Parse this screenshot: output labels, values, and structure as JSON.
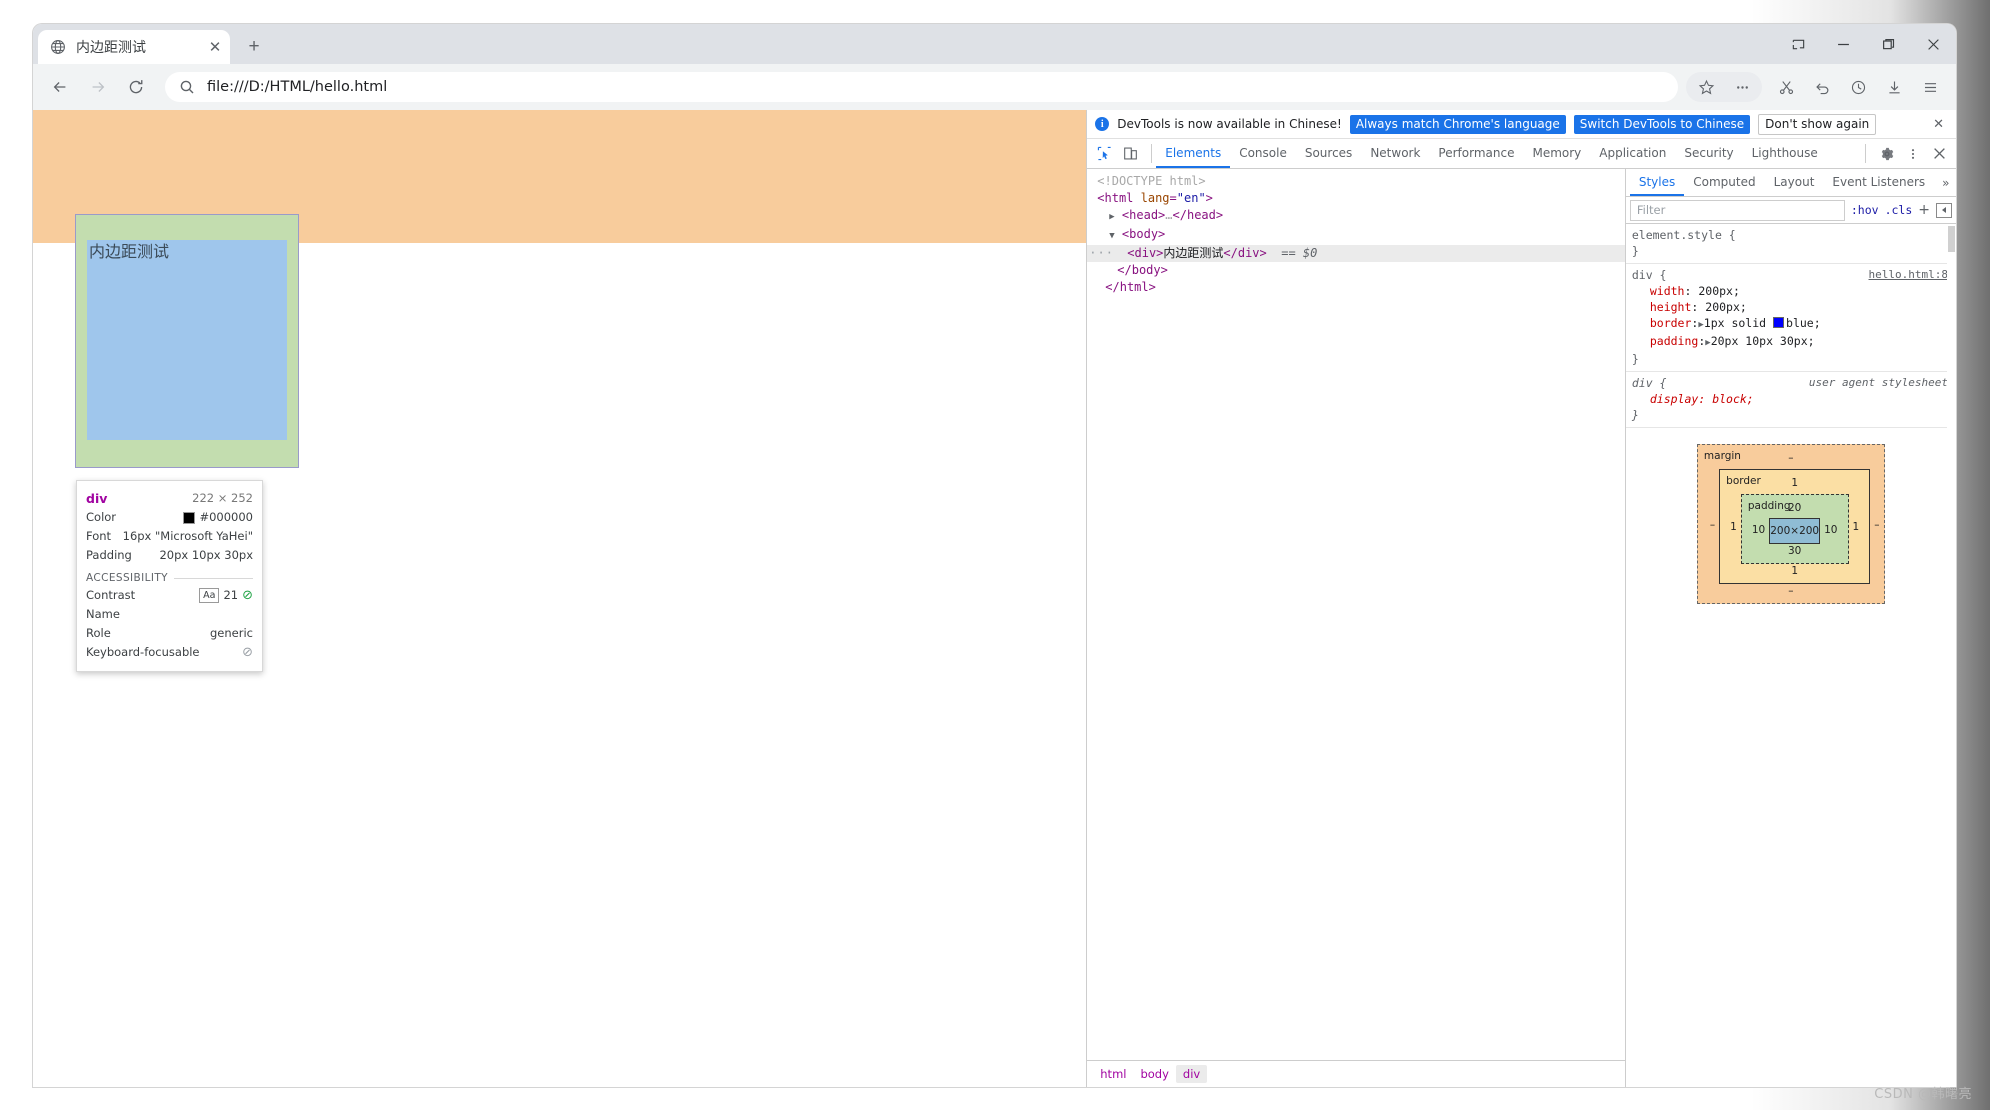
{
  "window": {
    "controls": [
      {
        "name": "cast-icon",
        "glyph": "cast"
      },
      {
        "name": "minimize-button",
        "glyph": "minimize"
      },
      {
        "name": "maximize-button",
        "glyph": "maximize"
      },
      {
        "name": "close-button",
        "glyph": "close"
      }
    ]
  },
  "tab": {
    "title": "内边距测试",
    "favicon": "globe-icon",
    "close_label": "✕",
    "newtab_label": "+"
  },
  "nav": {
    "back": "←",
    "forward": "→",
    "reload": "⟳",
    "url": "file:///D:/HTML/hello.html",
    "search_icon": "search-icon",
    "toolbar_icons": [
      "bookmark-star-icon",
      "extensions-ellipsis-icon",
      "scissors-icon",
      "undo-icon",
      "history-clock-icon",
      "download-icon",
      "menu-hamburger-icon"
    ]
  },
  "page": {
    "div_text": "内边距测试",
    "colors": {
      "content": "#9fc6ec",
      "padding": "#c3ddaf",
      "margin": "#f8cc9c",
      "border_outline": "#9a9aca"
    }
  },
  "tooltip": {
    "tag": "div",
    "dimensions": "222 × 252",
    "rows": [
      {
        "key": "Color",
        "value": "#000000",
        "swatch": "#000000"
      },
      {
        "key": "Font",
        "value": "16px \"Microsoft YaHei\""
      },
      {
        "key": "Padding",
        "value": "20px 10px 30px"
      }
    ],
    "accessibility_title": "ACCESSIBILITY",
    "a11y": [
      {
        "key": "Contrast",
        "badge": "Aa",
        "value": "21",
        "status": "pass"
      },
      {
        "key": "Name",
        "value": ""
      },
      {
        "key": "Role",
        "value": "generic"
      },
      {
        "key": "Keyboard-focusable",
        "value": "",
        "status": "no"
      }
    ]
  },
  "devtools": {
    "banner": {
      "icon": "info-icon",
      "message": "DevTools is now available in Chinese!",
      "buttons": [
        {
          "label": "Always match Chrome's language",
          "style": "blue"
        },
        {
          "label": "Switch DevTools to Chinese",
          "style": "blue"
        },
        {
          "label": "Don't show again",
          "style": "plain"
        }
      ],
      "close": "✕"
    },
    "tool_icons": [
      "inspect-element-icon",
      "device-toolbar-icon"
    ],
    "tabs": [
      {
        "label": "Elements",
        "selected": true
      },
      {
        "label": "Console",
        "selected": false
      },
      {
        "label": "Sources",
        "selected": false
      },
      {
        "label": "Network",
        "selected": false
      },
      {
        "label": "Performance",
        "selected": false
      },
      {
        "label": "Memory",
        "selected": false
      },
      {
        "label": "Application",
        "selected": false
      },
      {
        "label": "Security",
        "selected": false
      },
      {
        "label": "Lighthouse",
        "selected": false
      }
    ],
    "right_icons": [
      "settings-gear-icon",
      "more-vertical-icon",
      "close-devtools-icon"
    ],
    "dom": {
      "lines": [
        {
          "indent": 0,
          "parts": [
            {
              "t": "cm",
              "v": "<!DOCTYPE html>"
            }
          ]
        },
        {
          "indent": 0,
          "parts": [
            {
              "t": "tg",
              "v": "<html "
            },
            {
              "t": "at",
              "v": "lang"
            },
            {
              "t": "tg",
              "v": "="
            },
            {
              "t": "av",
              "v": "\"en\""
            },
            {
              "t": "tg",
              "v": ">"
            }
          ]
        },
        {
          "indent": 1,
          "caret": "right",
          "parts": [
            {
              "t": "tg",
              "v": "<head>"
            },
            {
              "t": "cm",
              "v": "…"
            },
            {
              "t": "tg",
              "v": "</head>"
            }
          ]
        },
        {
          "indent": 1,
          "caret": "down",
          "parts": [
            {
              "t": "tg",
              "v": "<body>"
            }
          ]
        },
        {
          "indent": 2,
          "selected": true,
          "dots": "···",
          "parts": [
            {
              "t": "tg",
              "v": "<div>"
            },
            {
              "t": "txt",
              "v": "内边距测试"
            },
            {
              "t": "tg",
              "v": "</div>"
            },
            {
              "t": "dollar",
              "v": "  == $0"
            }
          ]
        },
        {
          "indent": 1,
          "parts": [
            {
              "t": "tg",
              "v": "</body>"
            }
          ]
        },
        {
          "indent": 0,
          "parts": [
            {
              "t": "tg",
              "v": "</html>"
            }
          ]
        }
      ]
    },
    "breadcrumbs": [
      {
        "label": "html",
        "selected": false
      },
      {
        "label": "body",
        "selected": false
      },
      {
        "label": "div",
        "selected": true
      }
    ],
    "styles": {
      "tabs": [
        {
          "label": "Styles",
          "selected": true
        },
        {
          "label": "Computed",
          "selected": false
        },
        {
          "label": "Layout",
          "selected": false
        },
        {
          "label": "Event Listeners",
          "selected": false
        }
      ],
      "more": "»",
      "filter_placeholder": "Filter",
      "hov_label": ":hov",
      "cls_label": ".cls",
      "plus_label": "+",
      "rules": [
        {
          "selector": "element.style {",
          "source": "",
          "source_kind": "none",
          "declarations": [],
          "close": "}"
        },
        {
          "selector": "div {",
          "source": "hello.html:8",
          "source_kind": "link",
          "declarations": [
            {
              "prop": "width",
              "value": "200px;",
              "expandable": false
            },
            {
              "prop": "height",
              "value": "200px;",
              "expandable": false
            },
            {
              "prop": "border",
              "value": "1px solid",
              "expandable": true,
              "swatch": "#0000ff",
              "value_tail": "blue;"
            },
            {
              "prop": "padding",
              "value": "20px 10px 30px;",
              "expandable": true
            }
          ],
          "close": "}"
        },
        {
          "selector": "div {",
          "source": "user agent stylesheet",
          "source_kind": "ua",
          "italic": true,
          "declarations": [
            {
              "prop": "display",
              "value": "block;",
              "expandable": false
            }
          ],
          "close": "}"
        }
      ],
      "box_model": {
        "margin_label": "margin",
        "margin_top": "–",
        "margin_right": "–",
        "margin_bottom": "–",
        "margin_left": "–",
        "border_label": "border",
        "border_top": "1",
        "border_right": "1",
        "border_bottom": "1",
        "border_left": "1",
        "padding_label": "padding",
        "padding_top": "20",
        "padding_right": "10",
        "padding_bottom": "30",
        "padding_left": "10",
        "content_size": "200×200"
      }
    }
  },
  "watermark": "CSDN @韩曙亮"
}
